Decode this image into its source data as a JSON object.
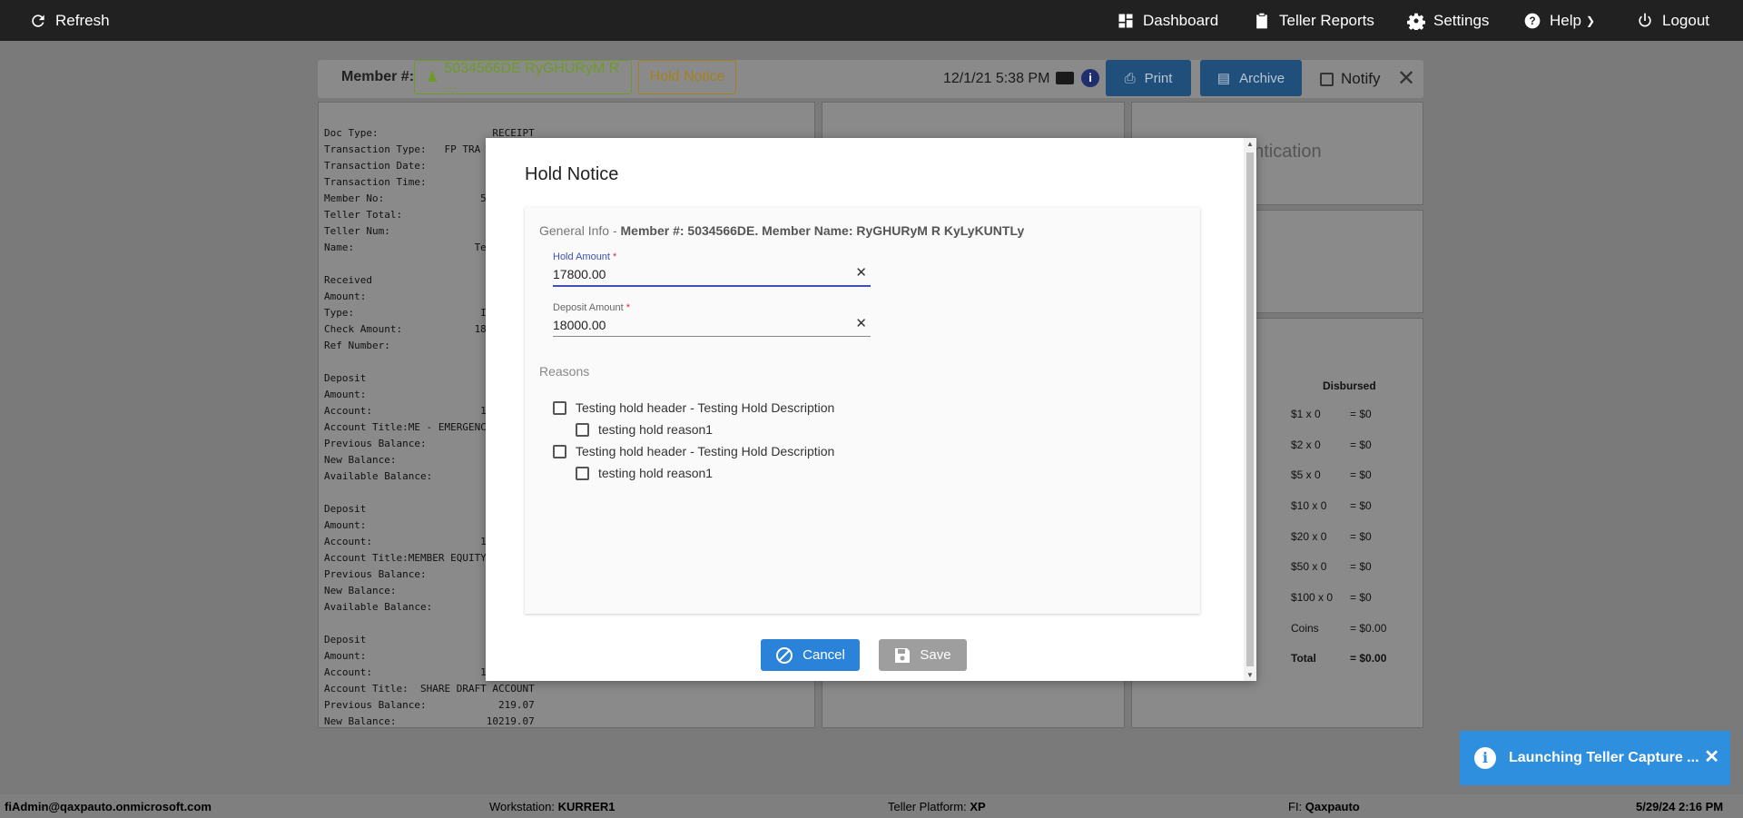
{
  "topbar": {
    "refresh": "Refresh",
    "dashboard": "Dashboard",
    "teller_reports": "Teller Reports",
    "settings": "Settings",
    "help": "Help",
    "logout": "Logout"
  },
  "toolbar": {
    "member_label": "Member #:",
    "member_chip": "5034566DE RyGHURyM R ...",
    "hold_notice_chip": "Hold Notice",
    "datetime": "12/1/21 5:38 PM",
    "info": "i",
    "print": "Print",
    "archive": "Archive",
    "notify": "Notify",
    "close": "✕"
  },
  "receipt": {
    "text": "Doc Type:                   RECEIPT\nTransaction Type:   FP TRA\nTransaction Date:\nTransaction Time:\nMember No:                5\nTeller Total:\nTeller Num:\nName:                    Tes\n\nReceived\nAmount:\nType:                     IN\nCheck Amount:            18\nRef Number:\n\nDeposit\nAmount:\nAccount:                  1\nAccount Title:ME - EMERGENC\nPrevious Balance:\nNew Balance:\nAvailable Balance:\n\nDeposit\nAmount:\nAccount:                  1\nAccount Title:MEMBER EQUITY\nPrevious Balance:\nNew Balance:\nAvailable Balance:\n\nDeposit\nAmount:\nAccount:                  1\nAccount Title:  SHARE DRAFT ACCOUNT\nPrevious Balance:            219.07\nNew Balance:               10219.07"
  },
  "auth_panel": {
    "partial_text": "entication"
  },
  "disbursed": {
    "header": "Disbursed",
    "rows": [
      {
        "label": "$1 x 0",
        "value": "= $0"
      },
      {
        "label": "$2 x 0",
        "value": "= $0"
      },
      {
        "label": "$5 x 0",
        "value": "= $0"
      },
      {
        "label": "$10 x 0",
        "value": "= $0"
      },
      {
        "label": "$20 x 0",
        "value": "= $0"
      },
      {
        "label": "$50 x 0",
        "value": "= $0"
      },
      {
        "label": "$100 x 0",
        "value": "= $0"
      },
      {
        "label": "Coins",
        "value": "= $0.00"
      },
      {
        "label": "Total",
        "value": "= $0.00"
      }
    ]
  },
  "modal": {
    "title": "Hold Notice",
    "general_info_prefix": "General Info - ",
    "general_info_detail": "Member #: 5034566DE. Member Name: RyGHURyM R KyLyKUNTLy",
    "hold_amount": {
      "label": "Hold Amount",
      "required_mark": "*",
      "value": "17800.00"
    },
    "deposit_amount": {
      "label": "Deposit Amount",
      "required_mark": "*",
      "value": "18000.00"
    },
    "clear_icon": "✕",
    "reasons_label": "Reasons",
    "reasons": [
      {
        "header": "Testing hold header - Testing Hold Description",
        "reason": "testing hold reason1"
      },
      {
        "header": "Testing hold header - Testing Hold Description",
        "reason": "testing hold reason1"
      }
    ],
    "cancel": "Cancel",
    "save": "Save"
  },
  "toast": {
    "message": "Launching Teller Capture ...",
    "close": "✕",
    "icon": "i"
  },
  "statusbar": {
    "user": "fiAdmin@qaxpauto.onmicrosoft.com",
    "workstation_label": "Workstation: ",
    "workstation": "KURRER1",
    "platform_label": "Teller Platform: ",
    "platform": "XP",
    "fi_label": "FI: ",
    "fi": "Qaxpauto",
    "datetime": "5/29/24 2:16 PM"
  }
}
